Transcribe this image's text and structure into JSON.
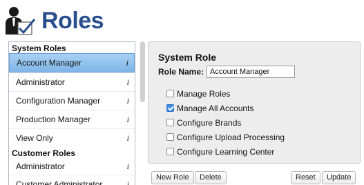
{
  "header": {
    "title": "Roles",
    "icon": "user-check-icon"
  },
  "left_panel": {
    "system_roles_header": "System Roles",
    "system_roles": [
      {
        "label": "Account Manager",
        "selected": true
      },
      {
        "label": "Administrator"
      },
      {
        "label": "Configuration Manager"
      },
      {
        "label": "Production Manager"
      },
      {
        "label": "View Only"
      }
    ],
    "customer_roles_header": "Customer Roles",
    "customer_roles": [
      {
        "label": "Administrator"
      },
      {
        "label": "Customer Administrator"
      }
    ],
    "info_glyph": "i"
  },
  "right_panel": {
    "title": "System Role",
    "role_name_label": "Role Name:",
    "role_name_value": "Account Manager",
    "permissions": [
      {
        "label": "Manage Roles",
        "checked": false
      },
      {
        "label": "Manage All Accounts",
        "checked": true
      },
      {
        "label": "Configure Brands",
        "checked": false
      },
      {
        "label": "Configure Upload Processing",
        "checked": false
      },
      {
        "label": "Configure Learning Center",
        "checked": false
      }
    ]
  },
  "buttons": {
    "new_role": "New Role",
    "delete": "Delete",
    "reset": "Reset",
    "update": "Update"
  },
  "colors": {
    "title_blue": "#2a4f8f",
    "selection_blue": "#7fb5e8",
    "checkbox_blue": "#3d8ee6"
  }
}
